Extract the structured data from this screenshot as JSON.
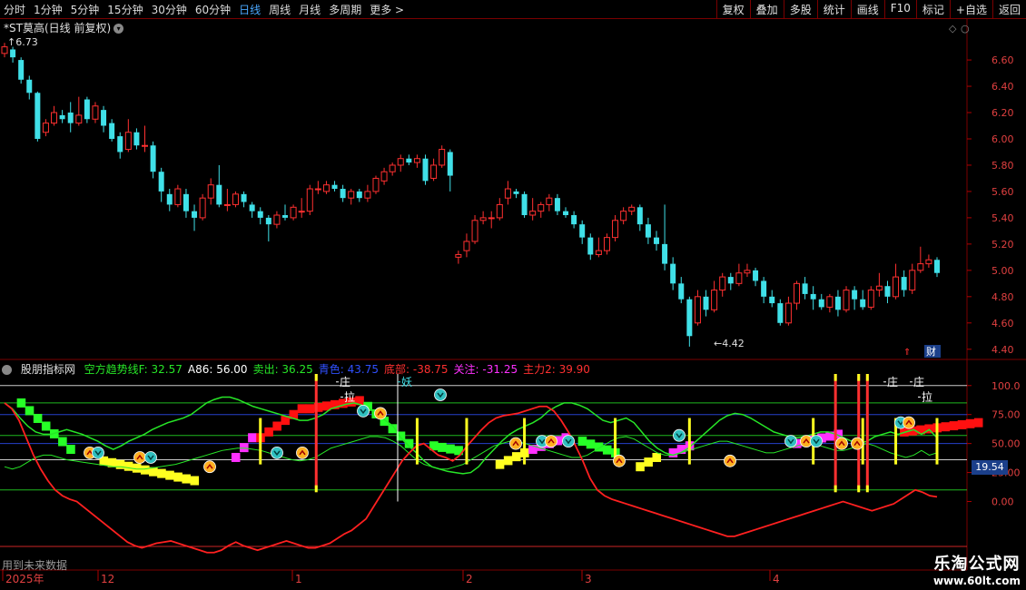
{
  "toolbar": {
    "periods": [
      "分时",
      "1分钟",
      "5分钟",
      "15分钟",
      "30分钟",
      "60分钟",
      "日线",
      "周线",
      "月线",
      "多周期",
      "更多 >"
    ],
    "active_period": "日线",
    "actions": [
      "复权",
      "叠加",
      "多股",
      "统计",
      "画线",
      "F10",
      "标记",
      "+自选",
      "返回"
    ]
  },
  "caption": {
    "title": "*ST莫高(日线 前复权)",
    "high_label": "6.73",
    "low_label": "4.42"
  },
  "price_axis": [
    "6.60",
    "6.40",
    "6.20",
    "6.00",
    "5.80",
    "5.60",
    "5.40",
    "5.20",
    "5.00",
    "4.80",
    "4.60",
    "4.40"
  ],
  "indicator": {
    "name": "股朋指标网",
    "items": [
      {
        "text": "空方趋势线F: 32.57",
        "color": "#27e627"
      },
      {
        "text": "A86: 56.00",
        "color": "#ffffff"
      },
      {
        "text": "卖出: 36.25",
        "color": "#27e627"
      },
      {
        "text": "青色: 43.75",
        "color": "#3050ff"
      },
      {
        "text": "底部: -38.75",
        "color": "#ff3030"
      },
      {
        "text": "关注: -31.25",
        "color": "#ff30ff"
      },
      {
        "text": "主力2: 39.90",
        "color": "#ff3030"
      }
    ],
    "axis": [
      "100.0",
      "75.00",
      "50.00",
      "25.00",
      "0.00"
    ],
    "current_value": "19.54",
    "markers": [
      "庄",
      "拉",
      "妖",
      "庄",
      "庄",
      "拉"
    ]
  },
  "date_axis": [
    "2025年",
    "12",
    "1",
    "2",
    "3",
    "4"
  ],
  "footer_note": "用到未来数据",
  "side_icons": [
    "财"
  ],
  "watermark": {
    "line1": "乐淘公式网",
    "line2": "www.60lt.com"
  },
  "chart_data": {
    "type": "candlestick",
    "candles": [
      [
        6.65,
        6.7,
        6.62,
        6.73
      ],
      [
        6.68,
        6.62,
        6.58,
        6.7
      ],
      [
        6.6,
        6.45,
        6.42,
        6.62
      ],
      [
        6.45,
        6.35,
        6.3,
        6.48
      ],
      [
        6.35,
        6.0,
        5.98,
        6.36
      ],
      [
        6.05,
        6.12,
        6.02,
        6.15
      ],
      [
        6.12,
        6.2,
        6.1,
        6.25
      ],
      [
        6.18,
        6.15,
        6.12,
        6.22
      ],
      [
        6.2,
        6.12,
        6.05,
        6.28
      ],
      [
        6.12,
        6.18,
        6.1,
        6.32
      ],
      [
        6.3,
        6.15,
        6.12,
        6.32
      ],
      [
        6.15,
        6.25,
        6.12,
        6.28
      ],
      [
        6.22,
        6.1,
        6.05,
        6.25
      ],
      [
        6.12,
        6.0,
        5.98,
        6.15
      ],
      [
        6.02,
        5.9,
        5.85,
        6.05
      ],
      [
        5.92,
        6.05,
        5.9,
        6.15
      ],
      [
        6.05,
        5.95,
        5.92,
        6.08
      ],
      [
        5.95,
        5.95,
        5.9,
        6.1
      ],
      [
        5.95,
        5.75,
        5.7,
        5.98
      ],
      [
        5.75,
        5.6,
        5.52,
        5.78
      ],
      [
        5.58,
        5.5,
        5.45,
        5.62
      ],
      [
        5.5,
        5.62,
        5.48,
        5.65
      ],
      [
        5.58,
        5.45,
        5.4,
        5.62
      ],
      [
        5.45,
        5.4,
        5.3,
        5.5
      ],
      [
        5.4,
        5.55,
        5.38,
        5.58
      ],
      [
        5.55,
        5.65,
        5.5,
        5.7
      ],
      [
        5.65,
        5.5,
        5.48,
        5.8
      ],
      [
        5.5,
        5.5,
        5.45,
        5.62
      ],
      [
        5.5,
        5.58,
        5.48,
        5.6
      ],
      [
        5.58,
        5.52,
        5.48,
        5.6
      ],
      [
        5.5,
        5.45,
        5.4,
        5.52
      ],
      [
        5.45,
        5.4,
        5.35,
        5.48
      ],
      [
        5.4,
        5.35,
        5.22,
        5.42
      ],
      [
        5.35,
        5.42,
        5.32,
        5.45
      ],
      [
        5.42,
        5.4,
        5.38,
        5.5
      ],
      [
        5.4,
        5.48,
        5.38,
        5.5
      ],
      [
        5.45,
        5.45,
        5.4,
        5.55
      ],
      [
        5.45,
        5.62,
        5.42,
        5.65
      ],
      [
        5.62,
        5.62,
        5.58,
        5.68
      ],
      [
        5.6,
        5.65,
        5.58,
        5.68
      ],
      [
        5.65,
        5.62,
        5.6,
        5.68
      ],
      [
        5.62,
        5.55,
        5.52,
        5.65
      ],
      [
        5.55,
        5.6,
        5.5,
        5.62
      ],
      [
        5.6,
        5.55,
        5.52,
        5.62
      ],
      [
        5.55,
        5.6,
        5.52,
        5.65
      ],
      [
        5.6,
        5.7,
        5.58,
        5.72
      ],
      [
        5.68,
        5.75,
        5.65,
        5.78
      ],
      [
        5.75,
        5.8,
        5.72,
        5.82
      ],
      [
        5.8,
        5.85,
        5.75,
        5.88
      ],
      [
        5.85,
        5.82,
        5.8,
        5.88
      ],
      [
        5.82,
        5.85,
        5.78,
        5.88
      ],
      [
        5.85,
        5.68,
        5.65,
        5.88
      ],
      [
        5.7,
        5.8,
        5.68,
        5.85
      ],
      [
        5.8,
        5.92,
        5.78,
        5.95
      ],
      [
        5.9,
        5.72,
        5.6,
        5.92
      ],
      [
        5.1,
        5.12,
        5.05,
        5.15
      ],
      [
        5.15,
        5.22,
        5.1,
        5.28
      ],
      [
        5.22,
        5.38,
        5.2,
        5.42
      ],
      [
        5.38,
        5.4,
        5.35,
        5.45
      ],
      [
        5.4,
        5.4,
        5.32,
        5.45
      ],
      [
        5.4,
        5.5,
        5.38,
        5.55
      ],
      [
        5.55,
        5.62,
        5.5,
        5.68
      ],
      [
        5.6,
        5.58,
        5.55,
        5.62
      ],
      [
        5.58,
        5.42,
        5.4,
        5.6
      ],
      [
        5.42,
        5.45,
        5.38,
        5.55
      ],
      [
        5.45,
        5.5,
        5.4,
        5.52
      ],
      [
        5.5,
        5.55,
        5.45,
        5.58
      ],
      [
        5.55,
        5.45,
        5.42,
        5.58
      ],
      [
        5.45,
        5.42,
        5.4,
        5.48
      ],
      [
        5.42,
        5.35,
        5.32,
        5.45
      ],
      [
        5.35,
        5.25,
        5.2,
        5.38
      ],
      [
        5.25,
        5.12,
        5.08,
        5.28
      ],
      [
        5.12,
        5.15,
        5.1,
        5.25
      ],
      [
        5.15,
        5.25,
        5.12,
        5.28
      ],
      [
        5.25,
        5.38,
        5.22,
        5.42
      ],
      [
        5.38,
        5.45,
        5.35,
        5.48
      ],
      [
        5.45,
        5.48,
        5.42,
        5.5
      ],
      [
        5.48,
        5.35,
        5.3,
        5.5
      ],
      [
        5.35,
        5.25,
        5.2,
        5.4
      ],
      [
        5.25,
        5.2,
        5.15,
        5.3
      ],
      [
        5.2,
        5.05,
        5.0,
        5.5
      ],
      [
        5.05,
        4.9,
        4.85,
        5.1
      ],
      [
        4.9,
        4.78,
        4.75,
        4.95
      ],
      [
        4.78,
        4.5,
        4.42,
        4.8
      ],
      [
        4.6,
        4.8,
        4.58,
        4.85
      ],
      [
        4.8,
        4.7,
        4.65,
        4.85
      ],
      [
        4.7,
        4.85,
        4.68,
        4.92
      ],
      [
        4.85,
        4.95,
        4.8,
        4.98
      ],
      [
        4.95,
        4.9,
        4.85,
        4.98
      ],
      [
        4.9,
        4.98,
        4.88,
        5.05
      ],
      [
        4.98,
        5.0,
        4.95,
        5.05
      ],
      [
        5.0,
        4.92,
        4.88,
        5.02
      ],
      [
        4.92,
        4.8,
        4.75,
        4.95
      ],
      [
        4.8,
        4.75,
        4.72,
        4.85
      ],
      [
        4.75,
        4.6,
        4.58,
        4.78
      ],
      [
        4.6,
        4.75,
        4.58,
        4.8
      ],
      [
        4.75,
        4.9,
        4.7,
        4.92
      ],
      [
        4.9,
        4.82,
        4.78,
        4.95
      ],
      [
        4.82,
        4.78,
        4.7,
        4.88
      ],
      [
        4.78,
        4.72,
        4.7,
        4.82
      ],
      [
        4.72,
        4.8,
        4.68,
        4.82
      ],
      [
        4.8,
        4.7,
        4.65,
        4.85
      ],
      [
        4.7,
        4.85,
        4.68,
        4.88
      ],
      [
        4.85,
        4.78,
        4.7,
        4.88
      ],
      [
        4.78,
        4.72,
        4.7,
        4.85
      ],
      [
        4.72,
        4.85,
        4.7,
        4.88
      ],
      [
        4.85,
        4.88,
        4.8,
        4.98
      ],
      [
        4.88,
        4.8,
        4.75,
        4.92
      ],
      [
        4.8,
        4.95,
        4.78,
        5.05
      ],
      [
        4.95,
        4.85,
        4.8,
        5.0
      ],
      [
        4.85,
        5.0,
        4.82,
        5.05
      ],
      [
        5.0,
        5.05,
        4.98,
        5.18
      ],
      [
        5.05,
        5.08,
        5.02,
        5.12
      ],
      [
        5.08,
        4.98,
        4.95,
        5.1
      ]
    ],
    "price_range": [
      4.35,
      6.78
    ],
    "indicator_range": [
      -45,
      110
    ],
    "green_line": [
      85,
      80,
      72,
      65,
      60,
      58,
      58,
      60,
      62,
      60,
      58,
      55,
      52,
      48,
      45,
      48,
      52,
      55,
      58,
      62,
      65,
      68,
      70,
      72,
      75,
      80,
      85,
      88,
      90,
      90,
      88,
      85,
      82,
      80,
      78,
      76,
      74,
      72,
      70,
      70,
      72,
      75,
      80,
      82,
      84,
      85,
      83,
      80,
      75,
      70,
      65,
      55,
      48,
      42,
      35,
      30,
      28,
      26,
      25,
      24,
      25,
      30,
      38,
      45,
      52,
      58,
      62,
      65,
      68,
      72,
      78,
      82,
      85,
      85,
      83,
      80,
      75,
      70,
      68,
      70,
      72,
      68,
      60,
      52,
      46,
      42,
      40,
      42,
      46,
      52,
      58,
      64,
      70,
      74,
      76,
      75,
      72,
      68,
      64,
      60,
      58,
      56,
      55,
      56,
      58,
      60,
      60,
      58,
      55,
      52,
      50,
      52,
      56,
      58,
      60,
      58,
      60,
      62,
      58,
      62,
      55
    ],
    "green_line2": [
      30,
      28,
      30,
      34,
      38,
      40,
      40,
      38,
      36,
      35,
      34,
      33,
      32,
      31,
      30,
      30,
      29,
      28,
      28,
      29,
      30,
      31,
      32,
      34,
      36,
      38,
      40,
      42,
      44,
      45,
      46,
      46,
      45,
      44,
      42,
      40,
      38,
      36,
      35,
      36,
      38,
      42,
      46,
      48,
      50,
      52,
      54,
      56,
      56,
      55,
      52,
      48,
      42,
      36,
      32,
      30,
      28,
      28,
      30,
      32,
      36,
      40,
      44,
      48,
      50,
      52,
      52,
      50,
      48,
      46,
      44,
      42,
      40,
      38,
      38,
      40,
      44,
      48,
      52,
      55,
      56,
      54,
      50,
      46,
      42,
      40,
      40,
      42,
      44,
      46,
      48,
      50,
      52,
      52,
      50,
      48,
      46,
      44,
      42,
      42,
      44,
      46,
      48,
      50,
      50,
      48,
      46,
      44,
      44,
      46,
      48,
      50,
      48,
      45,
      42,
      40,
      38,
      40,
      44,
      40,
      42
    ],
    "red_line": [
      85,
      80,
      70,
      55,
      40,
      28,
      18,
      10,
      5,
      2,
      0,
      -5,
      -10,
      -15,
      -20,
      -25,
      -30,
      -35,
      -38,
      -40,
      -38,
      -36,
      -35,
      -34,
      -36,
      -38,
      -40,
      -42,
      -44,
      -44,
      -42,
      -38,
      -35,
      -38,
      -40,
      -42,
      -40,
      -38,
      -36,
      -34,
      -36,
      -38,
      -40,
      -40,
      -38,
      -36,
      -32,
      -28,
      -25,
      -20,
      -15,
      -5,
      5,
      15,
      25,
      35,
      42,
      48,
      50,
      45,
      40,
      38,
      35,
      40,
      48,
      55,
      62,
      68,
      72,
      74,
      75,
      76,
      78,
      80,
      82,
      82,
      78,
      70,
      60,
      48,
      35,
      20,
      10,
      5,
      2,
      0,
      -2,
      -4,
      -6,
      -8,
      -10,
      -12,
      -14,
      -16,
      -18,
      -20,
      -22,
      -24,
      -26,
      -28,
      -30,
      -30,
      -28,
      -26,
      -24,
      -22,
      -20,
      -18,
      -16,
      -14,
      -12,
      -10,
      -8,
      -6,
      -4,
      -2,
      0,
      -2,
      -4,
      -6,
      -8,
      -6,
      -4,
      -2,
      2,
      6,
      10,
      8,
      5,
      4
    ],
    "signal_lines": [
      {
        "x": 0.327,
        "color": "#ff3030"
      },
      {
        "x": 0.864,
        "color": "#ff3030"
      },
      {
        "x": 0.888,
        "color": "#ff3030"
      },
      {
        "x": 0.897,
        "color": "#ff3030"
      }
    ]
  }
}
